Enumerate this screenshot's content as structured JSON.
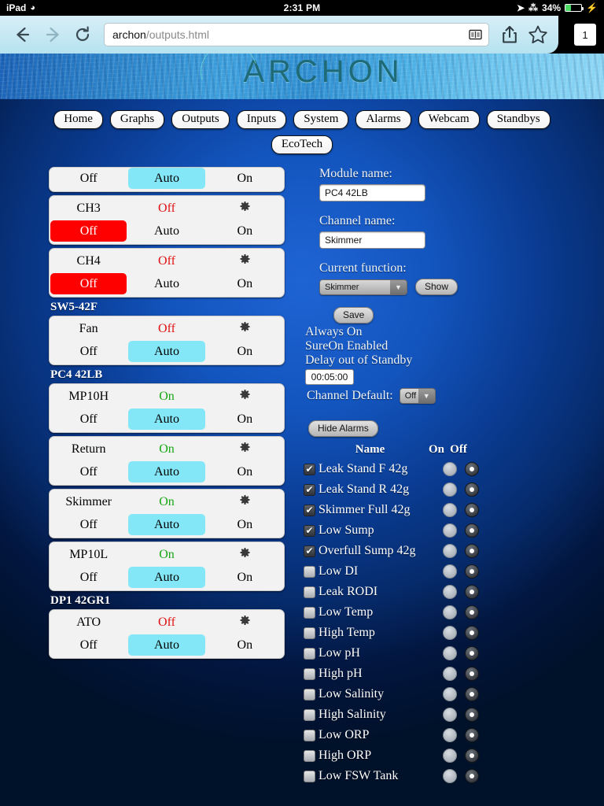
{
  "status_bar": {
    "carrier": "iPad",
    "wifi_icon": "wifi-icon",
    "time": "2:31 PM",
    "location_icon": "location-arrow-icon",
    "bluetooth_icon": "bluetooth-icon",
    "battery_percent": "34%",
    "charging_icon": "lightning-bolt-icon"
  },
  "browser": {
    "back_icon": "back-arrow-icon",
    "forward_icon": "forward-arrow-icon",
    "reload_icon": "reload-icon",
    "url_host": "archon",
    "url_path": "/outputs.html",
    "reader_icon": "reader-view-icon",
    "share_icon": "share-icon",
    "bookmark_icon": "bookmark-star-icon",
    "tab_count": "1"
  },
  "header": {
    "logo_text": "ARCHON",
    "logo_mark": "arc-circle-icon"
  },
  "nav": {
    "primary": [
      {
        "label": "Home"
      },
      {
        "label": "Graphs"
      },
      {
        "label": "Outputs"
      },
      {
        "label": "Inputs"
      },
      {
        "label": "System"
      },
      {
        "label": "Alarms"
      },
      {
        "label": "Webcam"
      },
      {
        "label": "Standbys"
      }
    ],
    "secondary": [
      {
        "label": "EcoTech"
      }
    ]
  },
  "button_labels": {
    "off": "Off",
    "auto": "Auto",
    "on": "On"
  },
  "channel_groups": [
    {
      "title": "",
      "show_title": false,
      "channels": [
        {
          "name": "",
          "state": "",
          "state_class": "",
          "selected": "auto",
          "clipped": true,
          "show_head": false
        },
        {
          "name": "CH3",
          "state": "Off",
          "state_class": "off",
          "selected": "off",
          "clipped": false,
          "show_head": true
        },
        {
          "name": "CH4",
          "state": "Off",
          "state_class": "off",
          "selected": "off",
          "clipped": false,
          "show_head": true
        }
      ]
    },
    {
      "title": "SW5-42F",
      "show_title": true,
      "channels": [
        {
          "name": "Fan",
          "state": "Off",
          "state_class": "off",
          "selected": "auto",
          "clipped": false,
          "show_head": true
        }
      ]
    },
    {
      "title": "PC4 42LB",
      "show_title": true,
      "channels": [
        {
          "name": "MP10H",
          "state": "On",
          "state_class": "on",
          "selected": "auto",
          "clipped": false,
          "show_head": true
        },
        {
          "name": "Return",
          "state": "On",
          "state_class": "on",
          "selected": "auto",
          "clipped": false,
          "show_head": true
        },
        {
          "name": "Skimmer",
          "state": "On",
          "state_class": "on",
          "selected": "auto",
          "clipped": false,
          "show_head": true
        },
        {
          "name": "MP10L",
          "state": "On",
          "state_class": "on",
          "selected": "auto",
          "clipped": false,
          "show_head": true
        }
      ]
    },
    {
      "title": "DP1 42GR1",
      "show_title": true,
      "channels": [
        {
          "name": "ATO",
          "state": "Off",
          "state_class": "off",
          "selected": "auto",
          "clipped": false,
          "show_head": true
        }
      ]
    }
  ],
  "gear_icon_name": "gear-icon",
  "detail": {
    "module_name_label": "Module name:",
    "module_name_value": "PC4 42LB",
    "channel_name_label": "Channel name:",
    "channel_name_value": "Skimmer",
    "current_function_label": "Current function:",
    "current_function_value": "Skimmer",
    "show_button": "Show",
    "save_button": "Save",
    "always_on": "Always On",
    "sure_on": "SureOn Enabled",
    "delay_label": "Delay out of Standby",
    "delay_value": "00:05:00",
    "channel_default_label": "Channel Default:",
    "channel_default_value": "Off",
    "hide_alarms_button": "Hide Alarms",
    "dropdown_arrow_icon": "chevron-down-icon"
  },
  "alarms": {
    "columns": {
      "name": "Name",
      "on": "On",
      "off": "Off"
    },
    "check_glyph": "✔",
    "rows": [
      {
        "label": "Leak Stand F 42g",
        "checked": true,
        "mode": "off"
      },
      {
        "label": "Leak Stand R 42g",
        "checked": true,
        "mode": "off"
      },
      {
        "label": "Skimmer Full 42g",
        "checked": true,
        "mode": "off"
      },
      {
        "label": "Low Sump",
        "checked": true,
        "mode": "off"
      },
      {
        "label": "Overfull Sump 42g",
        "checked": true,
        "mode": "off"
      },
      {
        "label": "Low DI",
        "checked": false,
        "mode": "off"
      },
      {
        "label": "Leak RODI",
        "checked": false,
        "mode": "off"
      },
      {
        "label": "Low Temp",
        "checked": false,
        "mode": "off"
      },
      {
        "label": "High Temp",
        "checked": false,
        "mode": "off"
      },
      {
        "label": "Low pH",
        "checked": false,
        "mode": "off"
      },
      {
        "label": "High pH",
        "checked": false,
        "mode": "off"
      },
      {
        "label": "Low Salinity",
        "checked": false,
        "mode": "off"
      },
      {
        "label": "High Salinity",
        "checked": false,
        "mode": "off"
      },
      {
        "label": "Low ORP",
        "checked": false,
        "mode": "off"
      },
      {
        "label": "High ORP",
        "checked": false,
        "mode": "off"
      },
      {
        "label": "Low FSW Tank",
        "checked": false,
        "mode": "off"
      }
    ]
  },
  "colors": {
    "auto_selected": "#84e7f7",
    "off_selected": "#fe0000",
    "state_on": "#17a814",
    "state_off": "#e01010",
    "page_blue": "#1355be",
    "logo_teal": "#1e6b77"
  }
}
